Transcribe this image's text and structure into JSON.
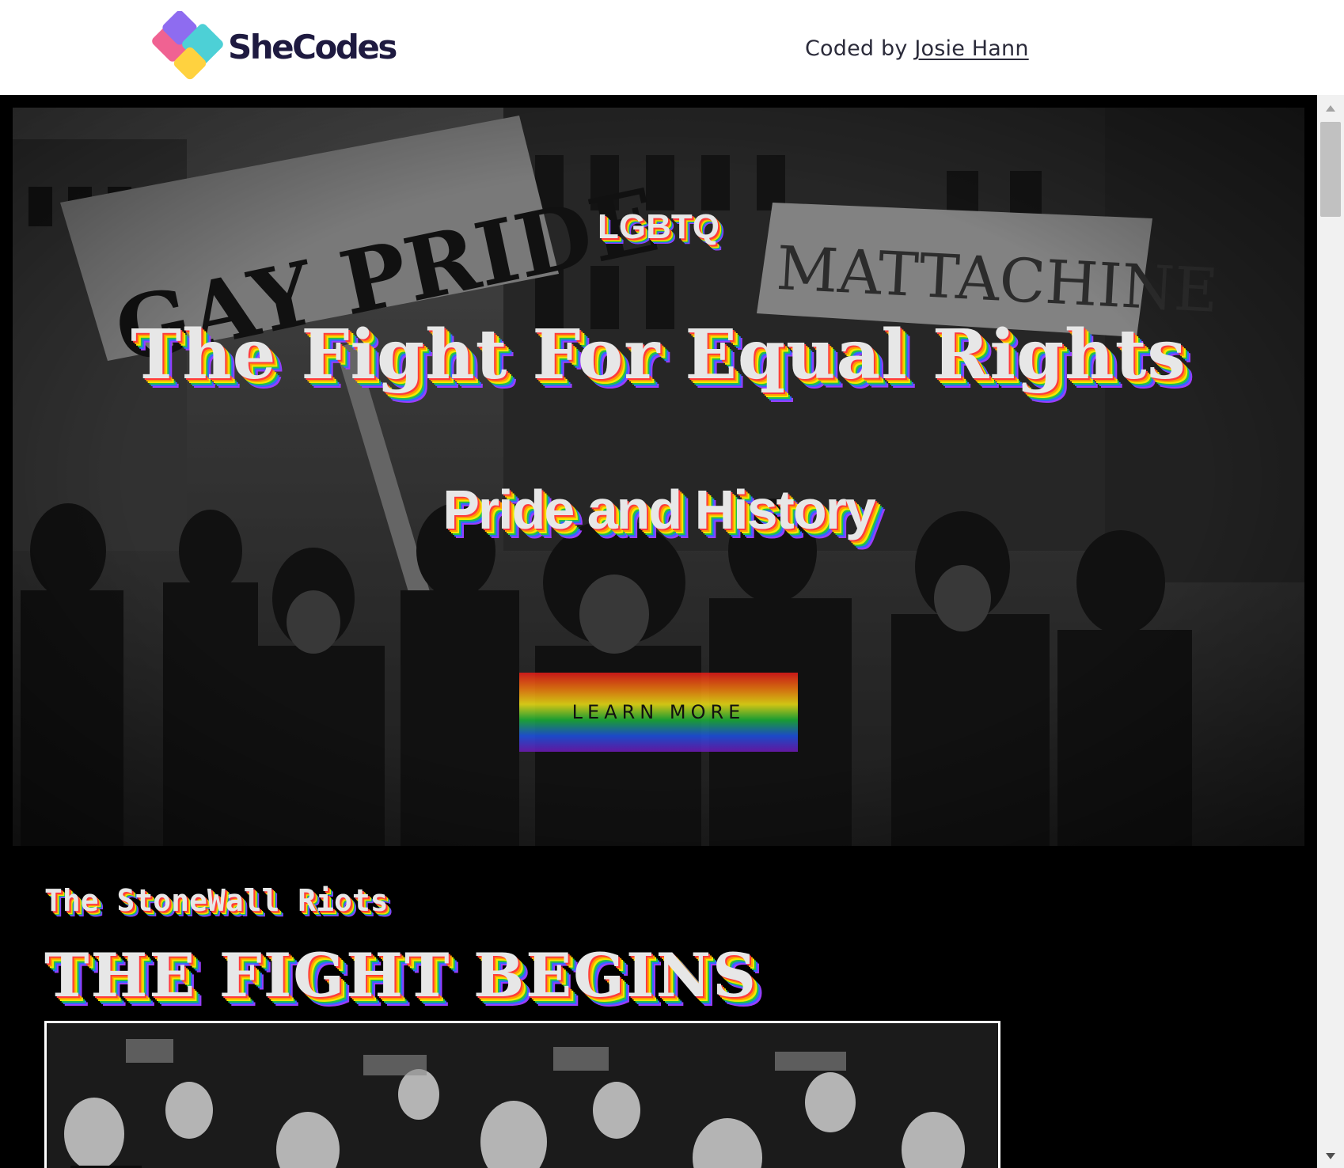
{
  "header": {
    "brand": "SheCodes",
    "credit_prefix": "Coded by",
    "credit_author": "Josie Hann"
  },
  "hero": {
    "kicker": "LGBTQ",
    "title": "The Fight For Equal Rights",
    "subtitle": "Pride and History",
    "button_label": "LEARN MORE"
  },
  "section": {
    "kicker": "The StoneWall Riots",
    "title": "THE FIGHT BEGINS"
  },
  "colors": {
    "brand_dark": "#1e1a40",
    "page_bg": "#000000",
    "rainbow": [
      "#e81a1a",
      "#f47a10",
      "#f3e415",
      "#1bb43a",
      "#1e54e8",
      "#7019b8"
    ]
  },
  "icons": {
    "logo": "shecodes-logo-icon",
    "scroll_up": "scroll-up-arrow-icon",
    "scroll_down": "scroll-down-arrow-icon"
  }
}
